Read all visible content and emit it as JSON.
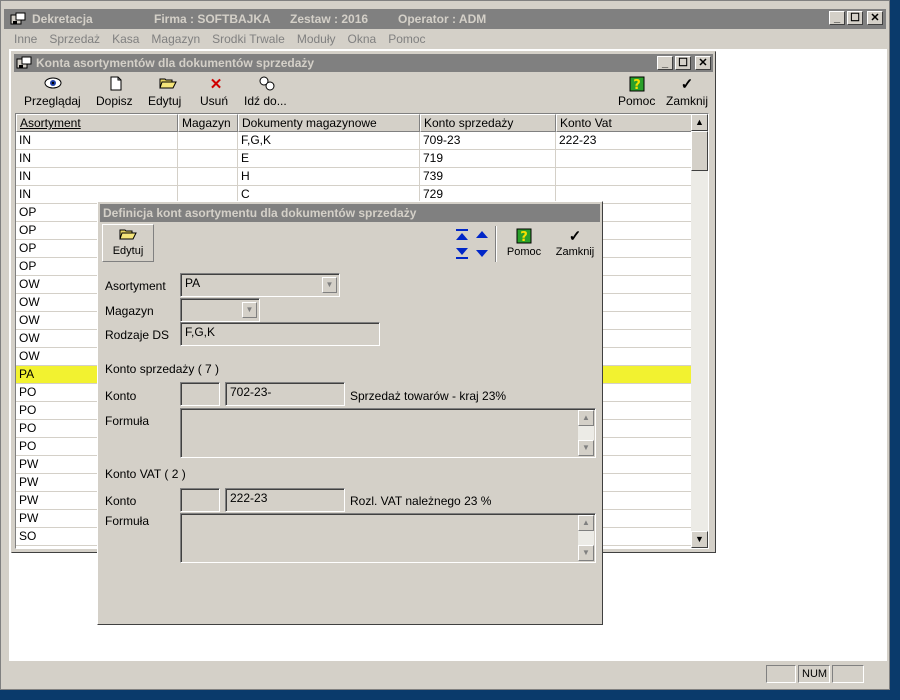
{
  "app": {
    "title": "Dekretacja",
    "firma": "Firma : SOFTBAJKA",
    "zestaw": "Zestaw : 2016",
    "operator": "Operator : ADM"
  },
  "menu": [
    "Inne",
    "Sprzedaż",
    "Kasa",
    "Magazyn",
    "Srodki Trwale",
    "Moduły",
    "Okna",
    "Pomoc"
  ],
  "child": {
    "title": "Konta asortymentów dla dokumentów sprzedaży",
    "toolbar": {
      "przegladaj": "Przeglądaj",
      "dopisz": "Dopisz",
      "edytuj": "Edytuj",
      "usun": "Usuń",
      "idz": "Idź do...",
      "pomoc": "Pomoc",
      "zamknij": "Zamknij"
    },
    "columns": [
      "Asortyment",
      "Magazyn",
      "Dokumenty magazynowe",
      "Konto sprzedaży",
      "Konto Vat"
    ],
    "rows": [
      [
        "IN",
        "",
        "F,G,K",
        "709-23",
        "222-23"
      ],
      [
        "IN",
        "",
        "E",
        "719",
        ""
      ],
      [
        "IN",
        "",
        "H",
        "739",
        ""
      ],
      [
        "IN",
        "",
        "C",
        "729",
        ""
      ],
      [
        "OP",
        "",
        "",
        "",
        ""
      ],
      [
        "OP",
        "",
        "",
        "",
        ""
      ],
      [
        "OP",
        "",
        "",
        "",
        ""
      ],
      [
        "OP",
        "",
        "",
        "",
        ""
      ],
      [
        "OW",
        "",
        "",
        "",
        ""
      ],
      [
        "OW",
        "",
        "",
        "",
        ""
      ],
      [
        "OW",
        "",
        "",
        "",
        ""
      ],
      [
        "OW",
        "",
        "",
        "",
        ""
      ],
      [
        "OW",
        "",
        "",
        "",
        ""
      ],
      [
        "PA",
        "",
        "",
        "",
        ""
      ],
      [
        "PO",
        "",
        "",
        "",
        ""
      ],
      [
        "PO",
        "",
        "",
        "",
        ""
      ],
      [
        "PO",
        "",
        "",
        "",
        ""
      ],
      [
        "PO",
        "",
        "",
        "",
        ""
      ],
      [
        "PW",
        "",
        "",
        "",
        ""
      ],
      [
        "PW",
        "",
        "",
        "",
        ""
      ],
      [
        "PW",
        "",
        "",
        "",
        ""
      ],
      [
        "PW",
        "",
        "",
        "",
        ""
      ],
      [
        "SO",
        "",
        "",
        "",
        ""
      ]
    ],
    "selected_row": 13
  },
  "dialog": {
    "title": "Definicja kont asortymentu dla dokumentów sprzedaży",
    "edytuj": "Edytuj",
    "pomoc": "Pomoc",
    "zamknij": "Zamknij",
    "asortyment_label": "Asortyment",
    "asortyment_value": "PA",
    "magazyn_label": "Magazyn",
    "magazyn_value": "",
    "rodzaje_label": "Rodzaje DS",
    "rodzaje_value": "F,G,K",
    "sprzedaz_header": "Konto sprzedaży ( 7 )",
    "konto_label": "Konto",
    "sprzedaz_prefix": "",
    "sprzedaz_konto": "702-23-",
    "sprzedaz_desc": "Sprzedaż towarów - kraj 23%",
    "formula_label": "Formuła",
    "vat_header": "Konto VAT ( 2 )",
    "vat_prefix": "",
    "vat_konto": "222-23",
    "vat_desc": "Rozl. VAT należnego 23 %"
  },
  "status": {
    "num": "NUM"
  },
  "colors": {
    "selected_row": "#f2f230",
    "title_inactive": "#808080",
    "face": "#d4d0c8"
  }
}
